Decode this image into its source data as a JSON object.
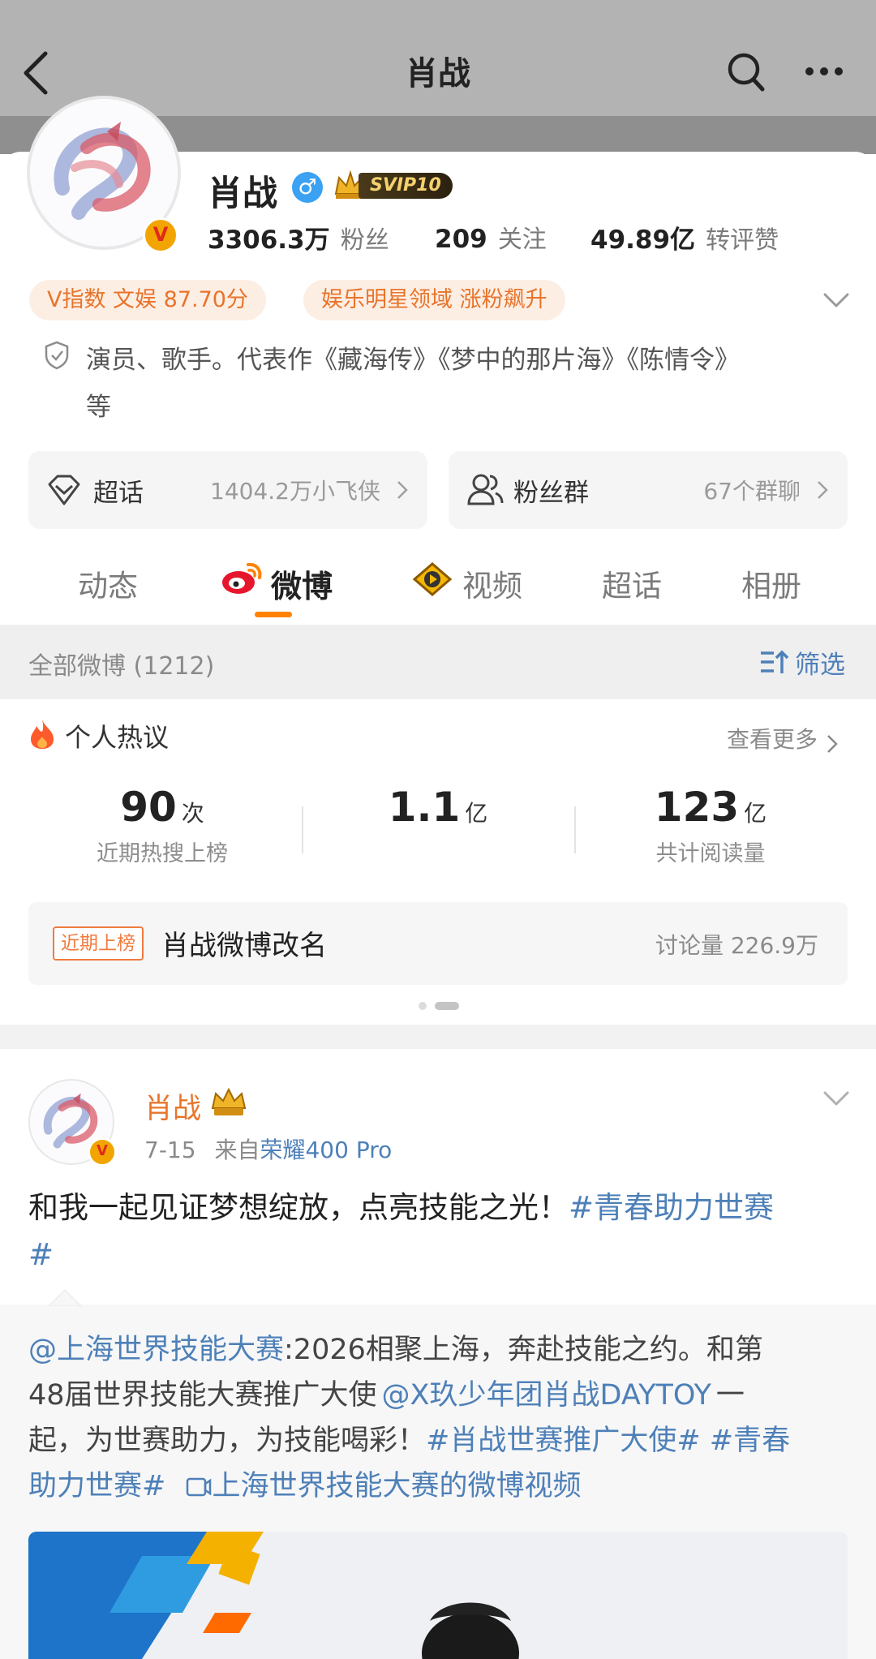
{
  "header": {
    "title": "肖战"
  },
  "profile": {
    "name": "肖战",
    "gender_symbol": "♂",
    "vip_badge": "SVIP10",
    "stats": [
      {
        "value": "3306.3万",
        "label": "粉丝"
      },
      {
        "value": "209",
        "label": "关注"
      },
      {
        "value": "49.89亿",
        "label": "转评赞"
      }
    ],
    "tags": [
      "V指数 文娱 87.70分",
      "娱乐明星领域 涨粉飙升"
    ],
    "bio_line1": "演员、歌手。代表作《藏海传》《梦中的那片海》《陈情令》",
    "bio_line2": "等",
    "supertopic": {
      "label": "超话",
      "detail": "1404.2万小飞侠"
    },
    "fan_group": {
      "label": "粉丝群",
      "detail": "67个群聊"
    }
  },
  "tabs": [
    "动态",
    "微博",
    "视频",
    "超话",
    "相册"
  ],
  "active_tab": "微博",
  "feed_bar": {
    "count_label": "全部微博 (1212)",
    "filter_label": "筛选"
  },
  "hot": {
    "title": "个人热议",
    "more": "查看更多",
    "metrics": [
      {
        "number": "90",
        "unit": "次",
        "desc": "近期热搜上榜"
      },
      {
        "number": "1.1",
        "unit": "亿",
        "desc": ""
      },
      {
        "number": "123",
        "unit": "亿",
        "desc": "共计阅读量"
      }
    ],
    "banner": {
      "tag": "近期上榜",
      "text": "肖战微博改名",
      "count": "讨论量 226.9万"
    }
  },
  "post": {
    "author": "肖战",
    "date": "7-15",
    "source_prefix": "来自",
    "source_device": "荣耀400 Pro",
    "text_plain": "和我一起见证梦想绽放，点亮技能之光！",
    "text_tag_a": "#青春助力世赛",
    "text_tag_b": "#",
    "repost": {
      "mention": "@上海世界技能大赛",
      "part1": ":2026相聚上海，奔赴技能之约。和第",
      "line2_plain": "48届世界技能大赛推广大使",
      "line2_mention": "@X玖少年团肖战DAYTOY",
      "line2_end": "一",
      "line3_plain": "起，为世赛助力，为技能喝彩！",
      "line3_tags": "#肖战世赛推广大使# #青春",
      "line4_tag": "助力世赛#",
      "line4_link": "上海世界技能大赛的微博视频"
    }
  },
  "colors": {
    "accent_orange": "#ff8200",
    "link_blue": "#4e80b8",
    "header_gray": "#b3b3b3"
  }
}
